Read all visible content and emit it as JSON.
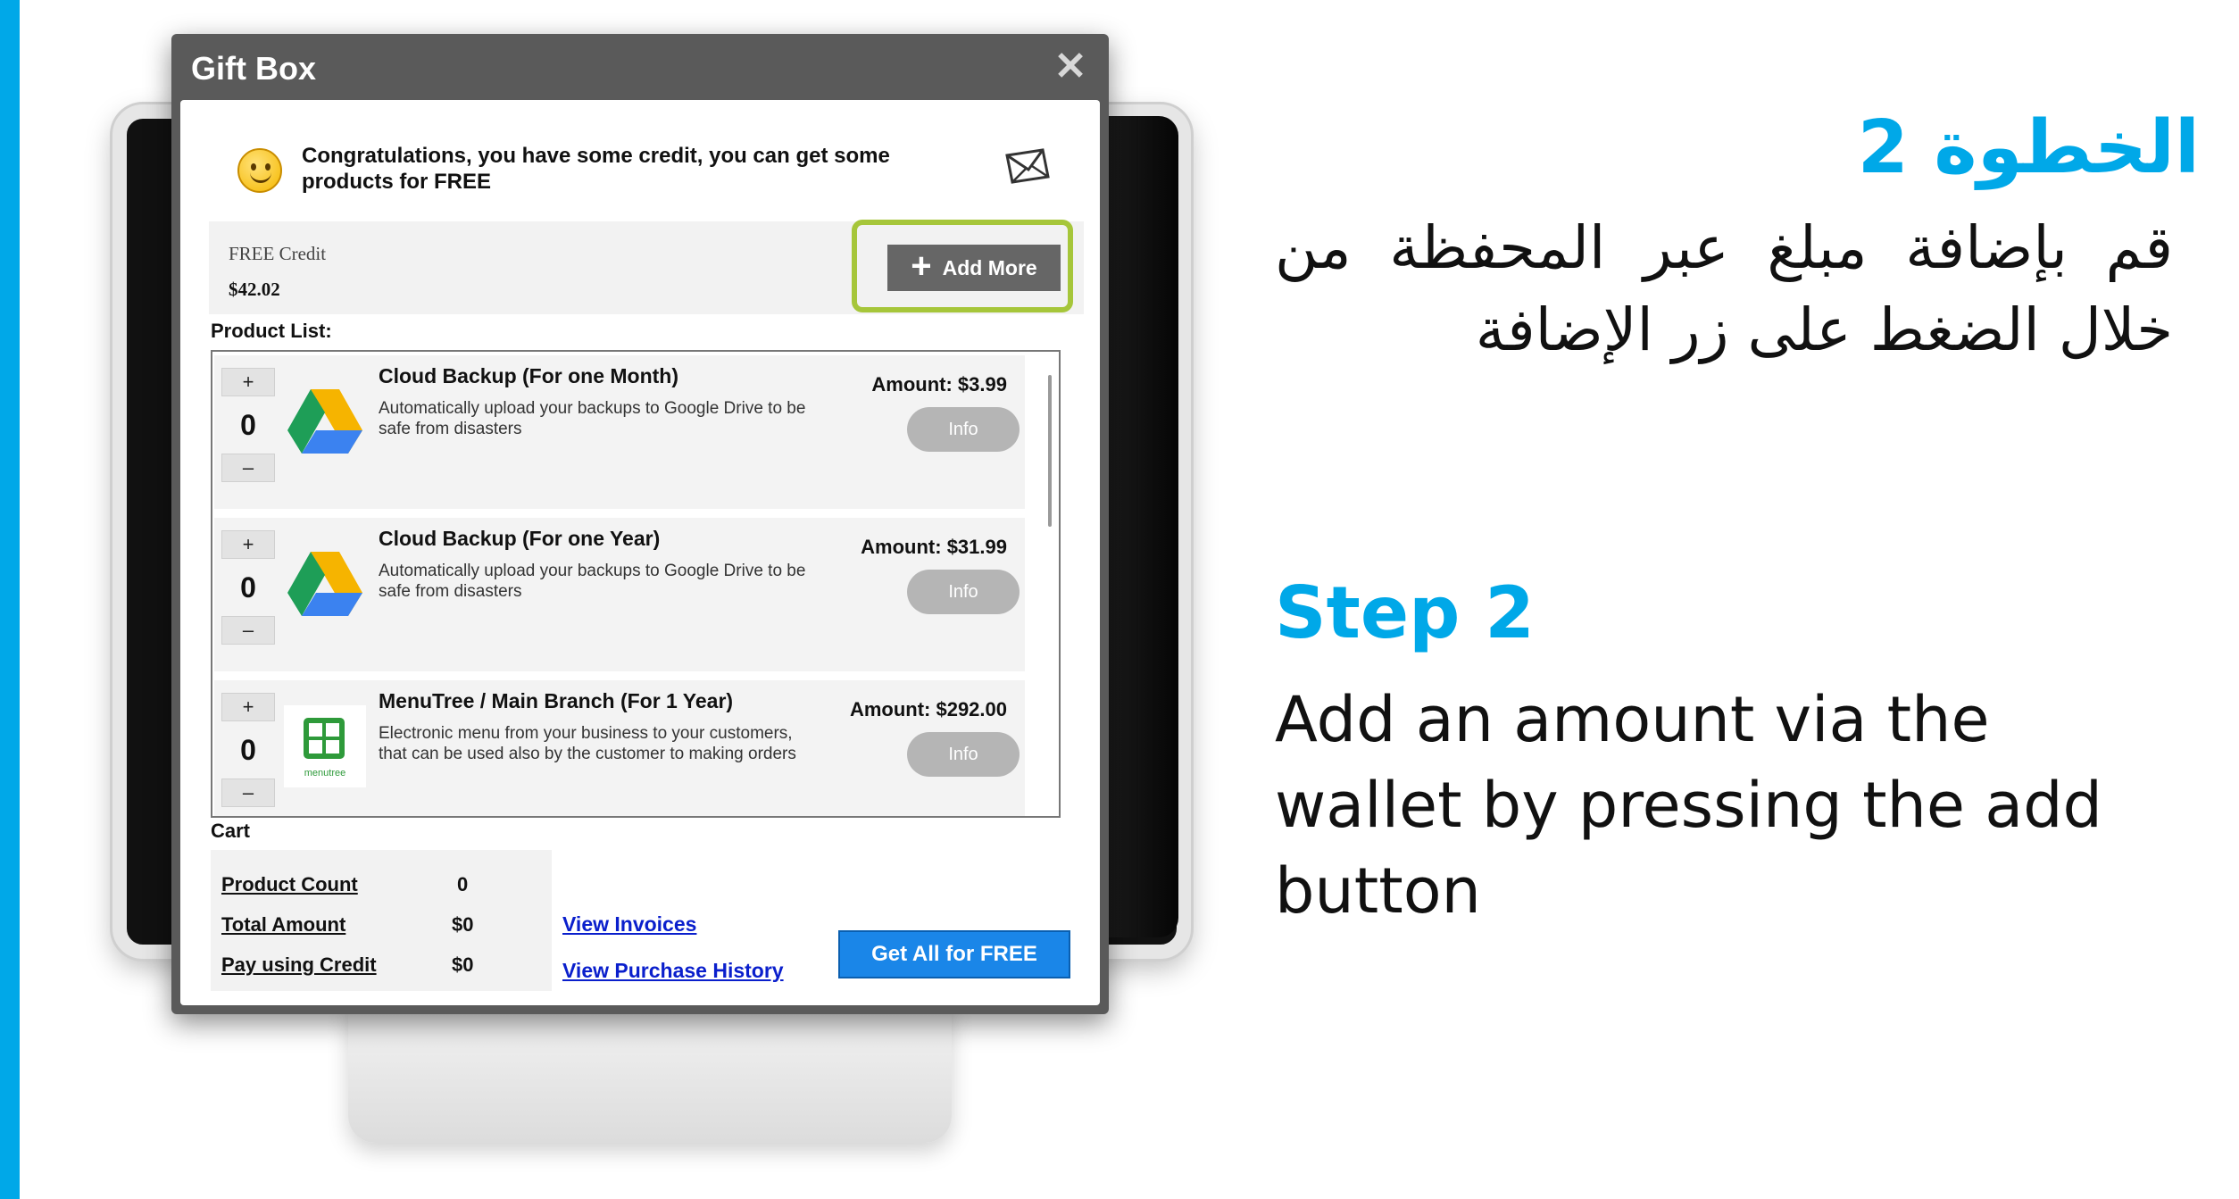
{
  "dialog": {
    "title": "Gift Box",
    "close_label": "✕",
    "congrats_text": "Congratulations, you have some credit, you can get some products for FREE",
    "credit": {
      "label": "FREE Credit",
      "value": "$42.02"
    },
    "add_more_label": "Add More",
    "product_list_label": "Product List:",
    "products": [
      {
        "qty": "0",
        "name": "Cloud Backup (For one Month)",
        "desc": "Automatically upload your backups to Google Drive to be safe from disasters",
        "amount": "Amount: $3.99",
        "info": "Info",
        "icon": "google-drive-icon"
      },
      {
        "qty": "0",
        "name": "Cloud Backup (For one Year)",
        "desc": "Automatically upload your backups to Google Drive to be safe from disasters",
        "amount": "Amount: $31.99",
        "info": "Info",
        "icon": "google-drive-icon"
      },
      {
        "qty": "0",
        "name": "MenuTree / Main Branch (For 1 Year)",
        "desc": "Electronic menu from your business to your customers, that can be used also by the customer to making orders",
        "amount": "Amount: $292.00",
        "info": "Info",
        "icon": "menutree-icon",
        "icon_caption": "menutree"
      }
    ],
    "stepper": {
      "plus": "+",
      "minus": "–"
    },
    "cart": {
      "label": "Cart",
      "rows": [
        {
          "key": "Product Count",
          "value": "0"
        },
        {
          "key": "Total Amount",
          "value": "$0"
        },
        {
          "key": "Pay using Credit",
          "value": "$0"
        }
      ]
    },
    "links": {
      "invoices": "View Invoices",
      "history": "View Purchase History"
    },
    "get_free_label": "Get All for FREE"
  },
  "instructions": {
    "ar_heading": "الخطوة 2",
    "ar_body": "قم بإضافة مبلغ عبر المحفظة من خلال الضغط على زر الإضافة",
    "en_heading": "Step 2",
    "en_body": "Add an amount via the wallet by pressing the add button"
  },
  "colors": {
    "accent": "#00a8e8",
    "highlight": "#a6c63a",
    "button_blue": "#1a86e8",
    "link": "#0a1fcc"
  }
}
